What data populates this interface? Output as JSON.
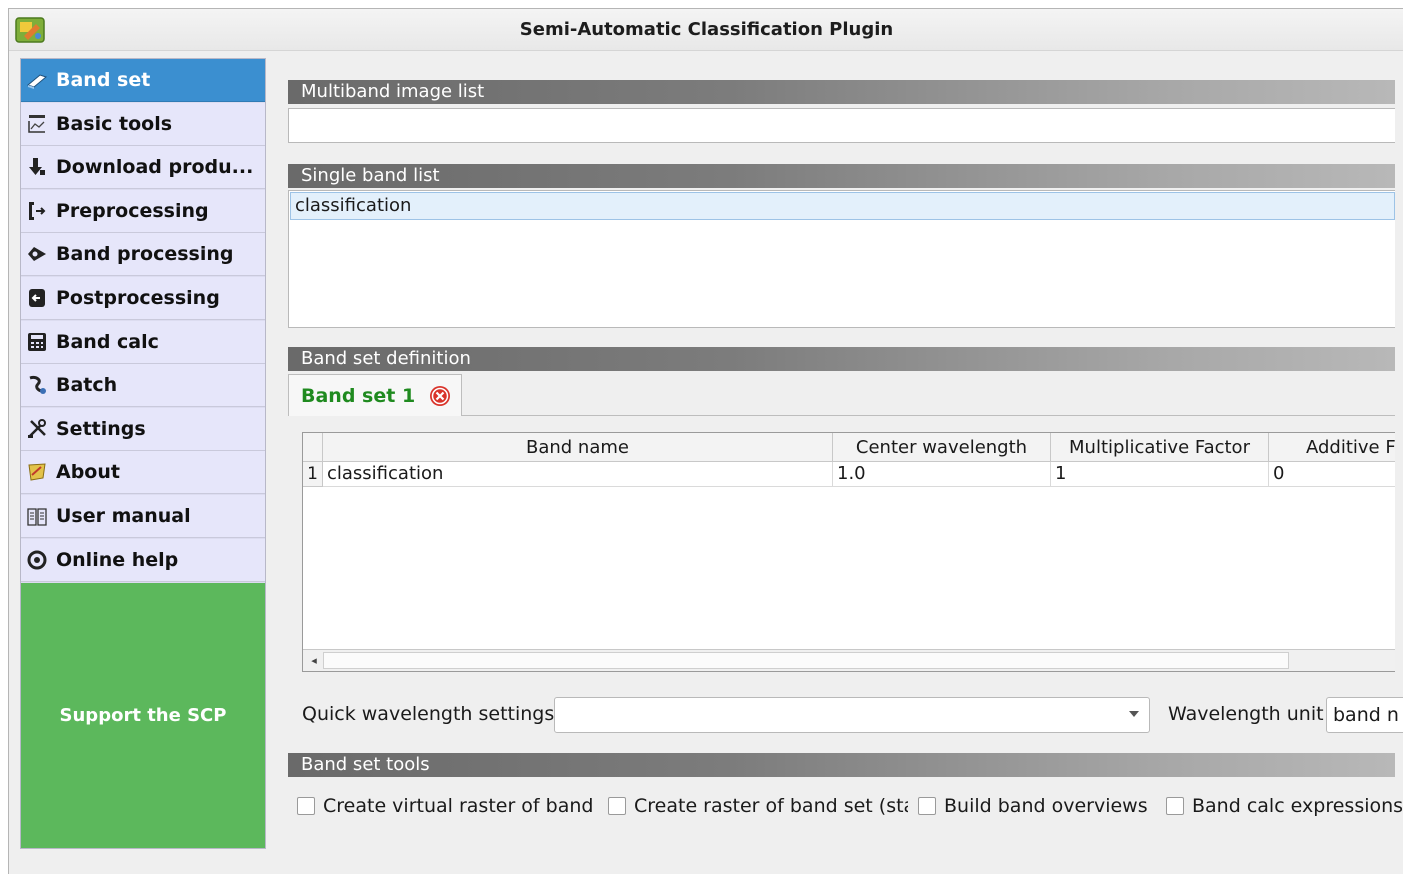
{
  "window": {
    "title": "Semi-Automatic Classification Plugin",
    "app_icon": "scp-plugin-icon"
  },
  "sidebar": {
    "items": [
      {
        "label": "Band set",
        "icon": "band-set-icon",
        "active": true
      },
      {
        "label": "Basic tools",
        "icon": "basic-tools-icon"
      },
      {
        "label": "Download produ...",
        "icon": "download-icon"
      },
      {
        "label": "Preprocessing",
        "icon": "preprocessing-icon"
      },
      {
        "label": "Band processing",
        "icon": "band-processing-icon"
      },
      {
        "label": "Postprocessing",
        "icon": "postprocessing-icon"
      },
      {
        "label": "Band calc",
        "icon": "calculator-icon"
      },
      {
        "label": "Batch",
        "icon": "batch-icon"
      },
      {
        "label": "Settings",
        "icon": "settings-icon"
      },
      {
        "label": "About",
        "icon": "about-icon"
      },
      {
        "label": "User manual",
        "icon": "user-manual-icon"
      },
      {
        "label": "Online help",
        "icon": "online-help-icon"
      }
    ],
    "support_label": "Support the SCP",
    "support_color": "#5cb85c",
    "active_color": "#3b8fd0"
  },
  "main": {
    "multiband_header": "Multiband image list",
    "multiband_value": "",
    "single_band_header": "Single band list",
    "single_band_items": [
      "classification"
    ],
    "band_set_definition_header": "Band set definition",
    "tab_label": "Band set 1",
    "table": {
      "columns": [
        "Band name",
        "Center wavelength",
        "Multiplicative Factor",
        "Additive F"
      ],
      "rows": [
        {
          "index": "1",
          "cells": [
            "classification",
            "1.0",
            "1",
            "0"
          ]
        }
      ]
    },
    "quick_wavelength_label": "Quick wavelength settings",
    "quick_wavelength_value": "",
    "wavelength_unit_label": "Wavelength unit",
    "wavelength_unit_value": "band n",
    "band_set_tools_header": "Band set tools",
    "checkboxes": [
      {
        "label": "Create virtual raster of band",
        "checked": false
      },
      {
        "label": "Create raster of band set (sta",
        "checked": false
      },
      {
        "label": "Build band overviews",
        "checked": false
      },
      {
        "label": "Band calc expressions",
        "checked": false
      }
    ]
  }
}
